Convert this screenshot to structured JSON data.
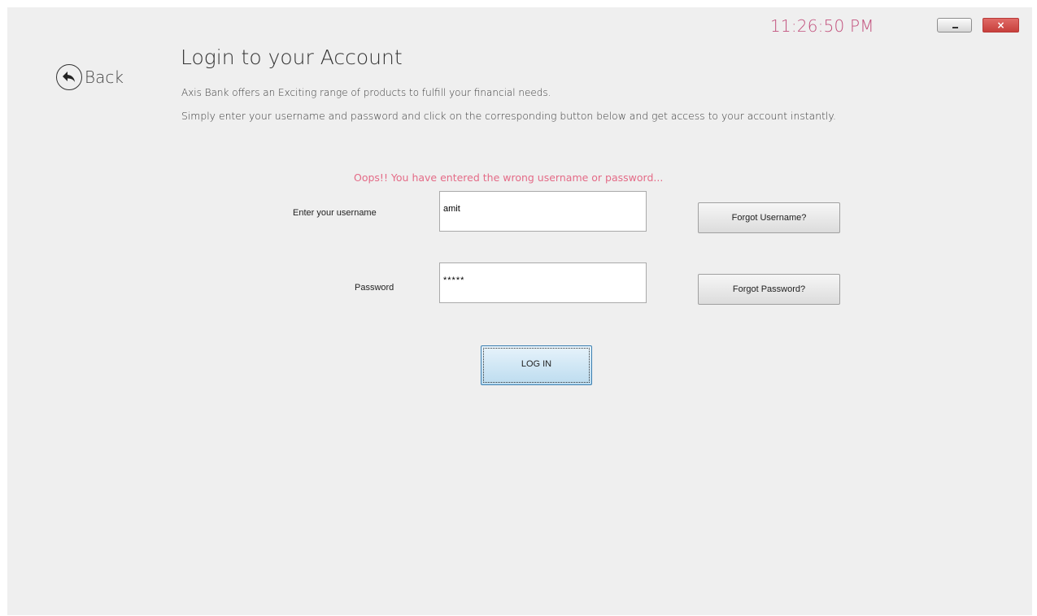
{
  "window": {
    "clock": "11:26:50 PM",
    "minimize_icon": "minimize-icon",
    "close_label": "×",
    "close_icon": "close-icon"
  },
  "back": {
    "label": "Back",
    "icon": "back-arrow-icon"
  },
  "header": {
    "title": "Login to your Account",
    "description_1": "Axis Bank offers an Exciting range of products to fulfill your financial needs.",
    "description_2": "Simply enter your username and password and click on the corresponding button below and get access to your account instantly."
  },
  "form": {
    "error_message": "Oops!! You have entered the wrong username or password...",
    "username_label": "Enter your username",
    "username_value": "amit",
    "password_label": "Password",
    "password_value": "*****",
    "forgot_username_label": "Forgot Username?",
    "forgot_password_label": "Forgot Password?",
    "login_label": "LOG IN"
  },
  "colors": {
    "background": "#efefef",
    "clock": "#c2507c",
    "error": "#e46b87",
    "close_button": "#c7403c",
    "login_button": "#bcdcef"
  }
}
